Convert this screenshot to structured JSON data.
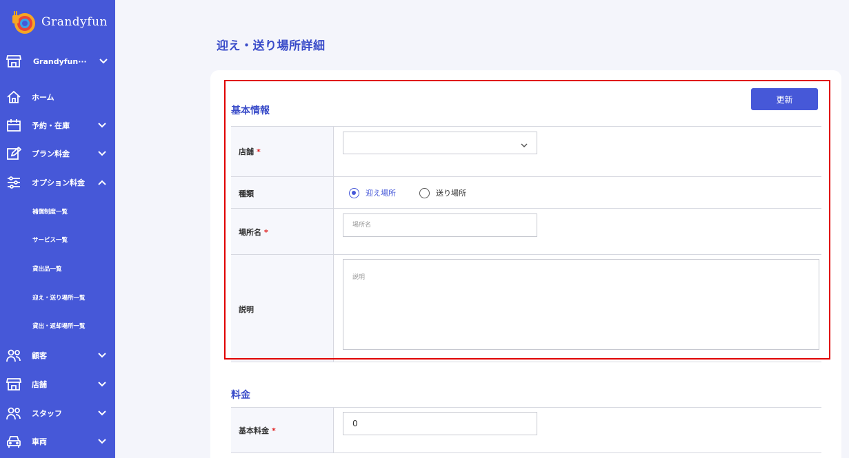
{
  "app": {
    "logo_text": "Grandyfun"
  },
  "sidebar": {
    "store_switcher": "Grandyfun···",
    "items": [
      {
        "label": "ホーム",
        "icon": "home-icon"
      },
      {
        "label": "予約・在庫",
        "icon": "calendar-icon"
      },
      {
        "label": "プラン料金",
        "icon": "edit-icon"
      },
      {
        "label": "オプション料金",
        "icon": "sliders-icon"
      },
      {
        "label": "顧客",
        "icon": "users-icon"
      },
      {
        "label": "店舗",
        "icon": "store-icon"
      },
      {
        "label": "スタッフ",
        "icon": "users-icon"
      },
      {
        "label": "車両",
        "icon": "car-icon"
      }
    ],
    "sub_items": [
      {
        "label": "補償制度一覧"
      },
      {
        "label": "サービス一覧"
      },
      {
        "label": "貸出品一覧"
      },
      {
        "label": "迎え・送り場所一覧"
      },
      {
        "label": "貸出・返却場所一覧"
      }
    ]
  },
  "page": {
    "title": "迎え・送り場所詳細"
  },
  "basic_info": {
    "title": "基本情報",
    "update_label": "更新",
    "store_label": "店舗",
    "required_mark": "*",
    "store_value": "",
    "type_label": "種類",
    "type_options": [
      "迎え場所",
      "送り場所"
    ],
    "type_selected": "迎え場所",
    "location_label": "場所名",
    "location_placeholder": "場所名",
    "description_label": "説明",
    "description_placeholder": "説明"
  },
  "pricing": {
    "title": "料金",
    "base_fee_label": "基本料金",
    "base_fee_value": "0"
  },
  "colors": {
    "accent": "#4658d8",
    "title": "#3a4cc9",
    "required": "#e02020",
    "highlight": "#e00000"
  }
}
